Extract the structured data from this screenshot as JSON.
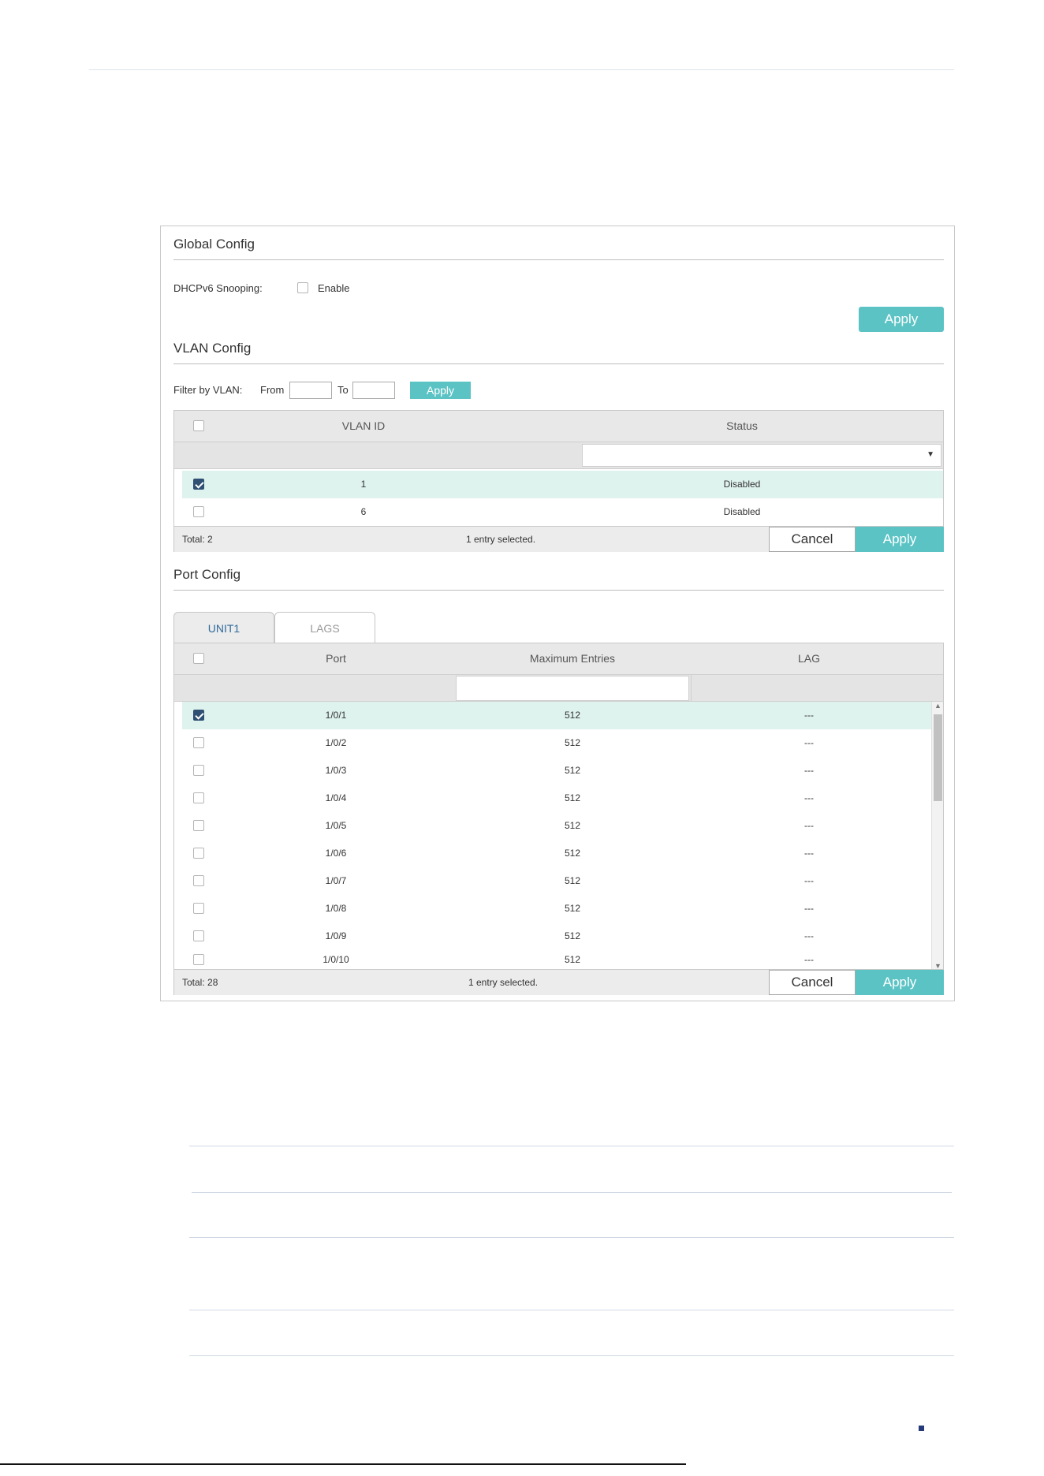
{
  "global": {
    "title": "Global Config",
    "snooping_label": "DHCPv6 Snooping:",
    "enable_label": "Enable",
    "enable_checked": false,
    "apply_label": "Apply"
  },
  "vlan": {
    "title": "VLAN Config",
    "filter_label": "Filter by VLAN:",
    "from_label": "From",
    "to_label": "To",
    "filter_apply": "Apply",
    "col_vlan": "VLAN ID",
    "col_status": "Status",
    "status_filter_value": "",
    "rows": [
      {
        "vlan": "1",
        "status": "Disabled",
        "checked": true
      },
      {
        "vlan": "6",
        "status": "Disabled",
        "checked": false
      }
    ],
    "total": "Total: 2",
    "selected": "1 entry selected.",
    "cancel": "Cancel",
    "apply": "Apply"
  },
  "port": {
    "title": "Port Config",
    "tabs": [
      {
        "label": "UNIT1",
        "active": true
      },
      {
        "label": "LAGS",
        "active": false
      }
    ],
    "col_port": "Port",
    "col_max": "Maximum Entries",
    "col_lag": "LAG",
    "rows": [
      {
        "port": "1/0/1",
        "max": "512",
        "lag": "---",
        "checked": true
      },
      {
        "port": "1/0/2",
        "max": "512",
        "lag": "---",
        "checked": false
      },
      {
        "port": "1/0/3",
        "max": "512",
        "lag": "---",
        "checked": false
      },
      {
        "port": "1/0/4",
        "max": "512",
        "lag": "---",
        "checked": false
      },
      {
        "port": "1/0/5",
        "max": "512",
        "lag": "---",
        "checked": false
      },
      {
        "port": "1/0/6",
        "max": "512",
        "lag": "---",
        "checked": false
      },
      {
        "port": "1/0/7",
        "max": "512",
        "lag": "---",
        "checked": false
      },
      {
        "port": "1/0/8",
        "max": "512",
        "lag": "---",
        "checked": false
      },
      {
        "port": "1/0/9",
        "max": "512",
        "lag": "---",
        "checked": false
      },
      {
        "port": "1/0/10",
        "max": "512",
        "lag": "---",
        "checked": false
      }
    ],
    "total": "Total: 28",
    "selected": "1 entry selected.",
    "cancel": "Cancel",
    "apply": "Apply"
  },
  "colors": {
    "accent": "#5cc3c5",
    "checkbox_checked": "#2f4f73",
    "selected_row": "#def2ee",
    "page_mark": "#263a7a"
  }
}
